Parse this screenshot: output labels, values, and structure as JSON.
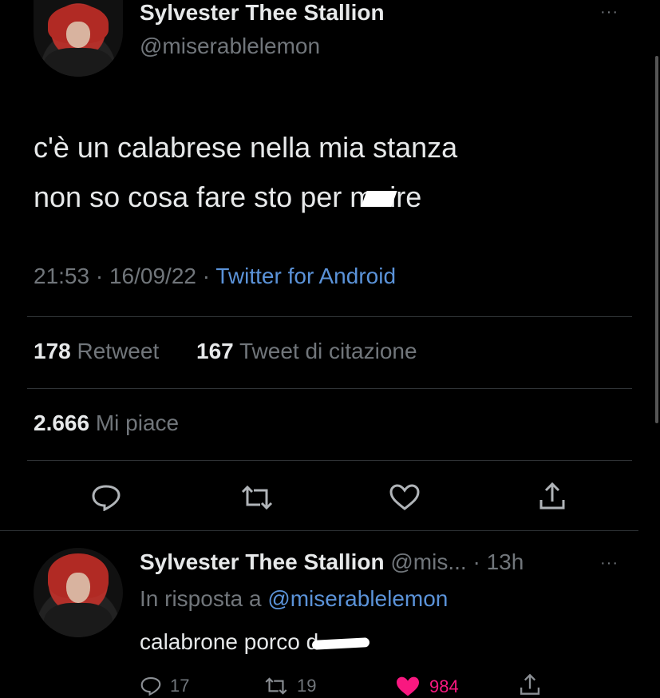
{
  "tweet": {
    "author_name": "Sylvester Thee Stallion",
    "author_handle": "@miserablelemon",
    "text_line1": "c'è un calabrese nella mia stanza",
    "text_line2_before": "non so cosa fare sto per m",
    "text_line2_after": "ire",
    "time": "21:53",
    "sep1": " · ",
    "date": "16/09/22",
    "sep2": " · ",
    "source": "Twitter for Android",
    "retweets_count": "178",
    "retweets_label": "Retweet",
    "quotes_count": "167",
    "quotes_label": "Tweet di citazione",
    "likes_count": "2.666",
    "likes_label": "Mi piace",
    "more_label": "···"
  },
  "actions": {
    "reply_icon": "reply-icon",
    "retweet_icon": "retweet-icon",
    "like_icon": "heart-icon",
    "share_icon": "share-icon"
  },
  "reply": {
    "author_name": "Sylvester Thee Stallion",
    "author_handle": "@mis...",
    "sep": " · ",
    "time": "13h",
    "in_reply_prefix": "In risposta a ",
    "in_reply_handle": "@miserablelemon",
    "text_before": "calabrone porco d",
    "reply_count": "17",
    "retweet_count": "19",
    "like_count": "984",
    "more_label": "···"
  },
  "colors": {
    "background": "#000000",
    "text": "#e7e9ea",
    "muted": "#71767b",
    "link": "#5b93d9",
    "like_active": "#f91880"
  }
}
